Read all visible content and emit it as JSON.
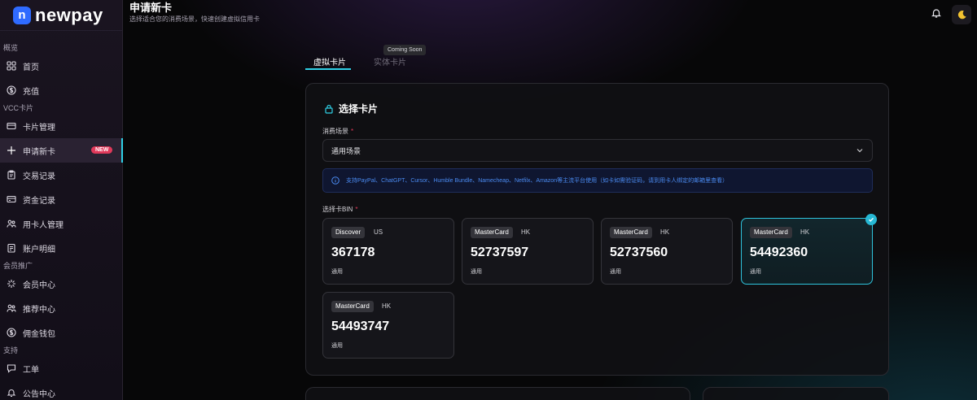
{
  "brand": {
    "logo_letter": "n",
    "name": "newpay"
  },
  "sidebar": {
    "sections": [
      {
        "label": "概览",
        "items": [
          {
            "label": "首页",
            "icon": "grid-icon"
          },
          {
            "label": "充值",
            "icon": "dollar-icon"
          }
        ]
      },
      {
        "label": "VCC卡片",
        "items": [
          {
            "label": "卡片管理",
            "icon": "card-icon"
          },
          {
            "label": "申请新卡",
            "icon": "plus-icon",
            "active": true,
            "badge": "NEW"
          },
          {
            "label": "交易记录",
            "icon": "clipboard-icon"
          },
          {
            "label": "资金记录",
            "icon": "wallet-icon"
          },
          {
            "label": "用卡人管理",
            "icon": "users-icon"
          },
          {
            "label": "账户明细",
            "icon": "list-icon"
          }
        ]
      },
      {
        "label": "会员推广",
        "items": [
          {
            "label": "会员中心",
            "icon": "sparkle-icon"
          },
          {
            "label": "推荐中心",
            "icon": "users-icon"
          },
          {
            "label": "佣金钱包",
            "icon": "dollar-icon"
          }
        ]
      },
      {
        "label": "支持",
        "items": [
          {
            "label": "工单",
            "icon": "chat-icon"
          },
          {
            "label": "公告中心",
            "icon": "bell-icon"
          }
        ]
      }
    ]
  },
  "header": {
    "title": "申请新卡",
    "subtitle": "选择适合您的消费场景，快速创建虚拟信用卡"
  },
  "tabs": {
    "virtual": "虚拟卡片",
    "physical": "实体卡片",
    "tooltip": "Coming Soon"
  },
  "card": {
    "title": "选择卡片",
    "scene_label": "消费场景",
    "required_mark": "*",
    "scene_value": "通用场景",
    "notice": "支持PayPal、ChatGPT、Cursor、Humble Bundle、Namecheap、Netfilx、Amazon等主流平台使用（如卡如需验证码，请到用卡人绑定的邮箱里查看）",
    "bin_label": "选择卡BIN",
    "bins": [
      {
        "brand": "Discover",
        "region": "US",
        "bin": "367178",
        "scene": "通用",
        "selected": false
      },
      {
        "brand": "MasterCard",
        "region": "HK",
        "bin": "52737597",
        "scene": "通用",
        "selected": false
      },
      {
        "brand": "MasterCard",
        "region": "HK",
        "bin": "52737560",
        "scene": "通用",
        "selected": false
      },
      {
        "brand": "MasterCard",
        "region": "HK",
        "bin": "54492360",
        "scene": "通用",
        "selected": true
      },
      {
        "brand": "MasterCard",
        "region": "HK",
        "bin": "54493747",
        "scene": "通用",
        "selected": false
      }
    ]
  },
  "colors": {
    "accent": "#2fd0e6",
    "badge": "#e0395a",
    "notice_text": "#4a8af0"
  }
}
